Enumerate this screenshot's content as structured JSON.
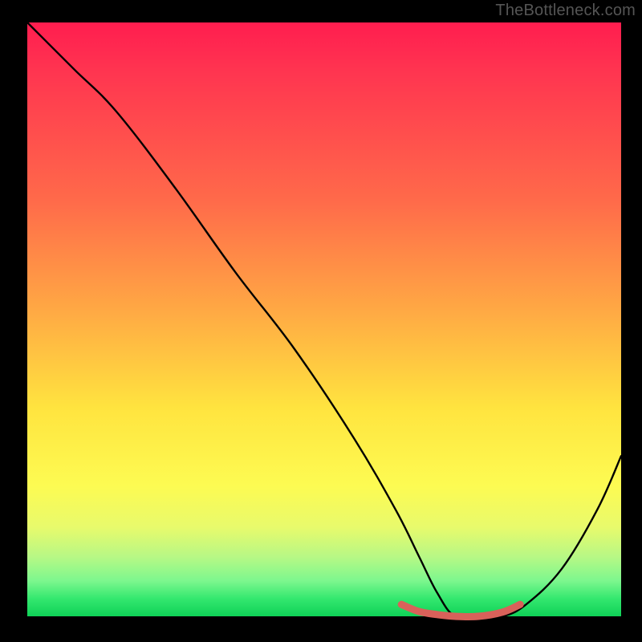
{
  "watermark": "TheBottleneck.com",
  "chart_data": {
    "type": "line",
    "title": "",
    "xlabel": "",
    "ylabel": "",
    "xlim": [
      0,
      100
    ],
    "ylim": [
      0,
      100
    ],
    "x": [
      0,
      3,
      8,
      15,
      25,
      35,
      45,
      55,
      62,
      66,
      69,
      72,
      76,
      80,
      84,
      90,
      96,
      100
    ],
    "y": [
      100,
      97,
      92,
      85,
      72,
      58,
      45,
      30,
      18,
      10,
      4,
      0,
      0,
      0,
      2,
      8,
      18,
      27
    ],
    "highlight": {
      "x": [
        63,
        66,
        69,
        72,
        76,
        80,
        83
      ],
      "y": [
        2,
        0.8,
        0.3,
        0,
        0,
        0.7,
        2
      ]
    },
    "colors": {
      "curve": "#000000",
      "highlight": "#d9615a",
      "gradient_top": "#ff1d4f",
      "gradient_bottom": "#0fd257",
      "frame": "#000000"
    }
  }
}
